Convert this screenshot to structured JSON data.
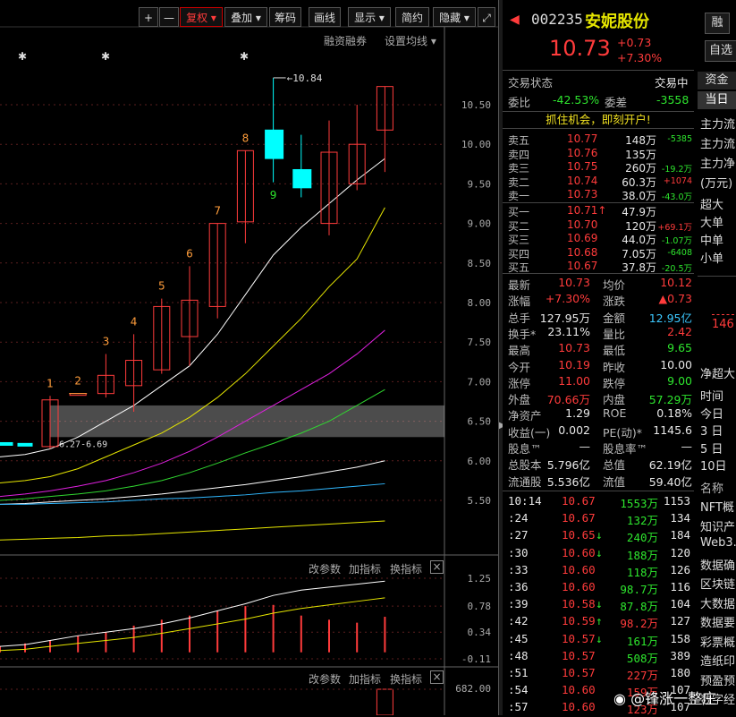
{
  "toolbar": {
    "plus": "+",
    "minus": "—",
    "fuquan": "复权",
    "diejia": "叠加",
    "chouma": "筹码",
    "huaxian": "画线",
    "xianshi": "显示",
    "jianyue": "简约",
    "yincang": "隐藏"
  },
  "chart_bar": {
    "rongzi": "融资融券",
    "shezhi": "设置均线"
  },
  "chart_data": {
    "type": "candlestick",
    "price_ticks": [
      "10.50",
      "10.00",
      "9.50",
      "9.00",
      "8.50",
      "8.00",
      "7.50",
      "7.00",
      "6.50",
      "6.00",
      "5.50"
    ],
    "candles": [
      {
        "open": 6.23,
        "close": 6.23,
        "high": 6.23,
        "low": 6.23,
        "color": "cyan"
      },
      {
        "open": 6.22,
        "close": 6.22,
        "high": 6.22,
        "low": 6.22,
        "color": "cyan"
      },
      {
        "open": 6.18,
        "close": 6.77,
        "high": 6.82,
        "low": 6.15,
        "color": "red"
      },
      {
        "open": 6.85,
        "close": 6.85,
        "high": 6.85,
        "low": 6.85,
        "color": "red"
      },
      {
        "open": 6.85,
        "close": 7.08,
        "high": 7.35,
        "low": 6.8,
        "color": "red"
      },
      {
        "open": 6.95,
        "close": 7.27,
        "high": 7.6,
        "low": 6.62,
        "color": "red"
      },
      {
        "open": 7.15,
        "close": 7.95,
        "high": 8.05,
        "low": 7.1,
        "color": "red"
      },
      {
        "open": 7.57,
        "close": 8.03,
        "high": 8.46,
        "low": 7.2,
        "color": "red"
      },
      {
        "open": 7.95,
        "close": 9.0,
        "high": 9.0,
        "low": 7.8,
        "color": "red"
      },
      {
        "open": 9.02,
        "close": 9.92,
        "high": 9.92,
        "low": 8.75,
        "color": "red"
      },
      {
        "open": 10.18,
        "close": 9.82,
        "high": 10.84,
        "low": 9.52,
        "color": "cyan"
      },
      {
        "open": 9.68,
        "close": 9.45,
        "high": 10.12,
        "low": 9.33,
        "color": "cyan"
      },
      {
        "open": 9.0,
        "close": 9.9,
        "high": 10.3,
        "low": 8.85,
        "color": "red"
      },
      {
        "open": 9.5,
        "close": 10.0,
        "high": 10.5,
        "low": 9.42,
        "color": "red"
      },
      {
        "open": 10.18,
        "close": 10.73,
        "high": 10.73,
        "low": 9.65,
        "color": "red"
      }
    ],
    "candle_labels": [
      "",
      "",
      "1",
      "2",
      "3",
      "4",
      "5",
      "6",
      "7",
      "8",
      "9",
      "",
      "",
      "",
      ""
    ],
    "max_label": "10.84",
    "range_label": "6.27-6.69",
    "band": [
      6.3,
      6.7
    ],
    "ma_lines": [
      {
        "color": "#ffffff",
        "values": [
          6.05,
          6.08,
          6.15,
          6.3,
          6.5,
          6.7,
          6.95,
          7.2,
          7.6,
          8.1,
          8.6,
          8.95,
          9.25,
          9.55,
          9.82
        ]
      },
      {
        "color": "#e6e600",
        "values": [
          5.72,
          5.75,
          5.8,
          5.9,
          6.05,
          6.2,
          6.35,
          6.55,
          6.8,
          7.1,
          7.45,
          7.8,
          8.2,
          8.55,
          9.2
        ]
      },
      {
        "color": "#e020e0",
        "values": [
          5.55,
          5.58,
          5.62,
          5.68,
          5.75,
          5.85,
          5.97,
          6.12,
          6.3,
          6.5,
          6.7,
          6.9,
          7.1,
          7.35,
          7.65
        ]
      },
      {
        "color": "#30d830",
        "values": [
          5.5,
          5.52,
          5.55,
          5.58,
          5.62,
          5.68,
          5.75,
          5.85,
          5.97,
          6.1,
          6.22,
          6.35,
          6.5,
          6.7,
          6.9
        ]
      },
      {
        "color": "#ffffff",
        "values": [
          5.45,
          5.46,
          5.48,
          5.5,
          5.52,
          5.55,
          5.58,
          5.62,
          5.66,
          5.7,
          5.75,
          5.8,
          5.86,
          5.92,
          6.0
        ]
      },
      {
        "color": "#30b8ff",
        "values": [
          5.45,
          5.45,
          5.46,
          5.47,
          5.48,
          5.5,
          5.52,
          5.53,
          5.55,
          5.57,
          5.6,
          5.62,
          5.65,
          5.68,
          5.71
        ]
      },
      {
        "color": "#e6e600",
        "values": [
          5.0,
          5.01,
          5.02,
          5.03,
          5.05,
          5.06,
          5.08,
          5.1,
          5.12,
          5.14,
          5.16,
          5.18,
          5.2,
          5.22,
          5.24
        ]
      }
    ],
    "indicator_ticks": [
      "1.25",
      "0.78",
      "0.34",
      "-0.11"
    ],
    "indicator_bars": [
      0.1,
      0.15,
      0.2,
      0.28,
      0.34,
      0.45,
      0.55,
      0.62,
      0.7,
      0.78,
      0.8,
      0.62,
      0.55,
      0.5,
      0.6
    ],
    "indicator_line1": [
      0.1,
      0.13,
      0.2,
      0.28,
      0.34,
      0.4,
      0.48,
      0.58,
      0.7,
      0.82,
      0.96,
      1.05,
      1.1,
      1.15,
      1.2
    ],
    "indicator_line2": [
      0.03,
      0.05,
      0.1,
      0.15,
      0.2,
      0.25,
      0.32,
      0.4,
      0.48,
      0.56,
      0.66,
      0.74,
      0.8,
      0.86,
      0.92
    ],
    "volume_tick": "682.00"
  },
  "indicator_bar": {
    "gai": "改参数",
    "jia": "加指标",
    "huan": "换指标",
    "close": "×"
  },
  "stock": {
    "code": "002235",
    "name": "安妮股份",
    "price": "10.73",
    "change": "+0.73",
    "change_pct": "+7.30%"
  },
  "status": {
    "label": "交易状态",
    "value": "交易中"
  },
  "weibi": {
    "label": "委比",
    "value": "-42.53%",
    "label2": "委差",
    "value2": "-3558"
  },
  "promo": "抓住机会，即刻开户!",
  "sells": [
    {
      "label": "卖五",
      "price": "10.77",
      "vol": "148万",
      "chg": "-5385",
      "chgcolor": "green"
    },
    {
      "label": "卖四",
      "price": "10.76",
      "vol": "135万",
      "chg": "",
      "chgcolor": "green"
    },
    {
      "label": "卖三",
      "price": "10.75",
      "vol": "260万",
      "chg": "-19.2万",
      "chgcolor": "green"
    },
    {
      "label": "卖二",
      "price": "10.74",
      "vol": "60.3万",
      "chg": "+1074",
      "chgcolor": "red"
    },
    {
      "label": "卖一",
      "price": "10.73",
      "vol": "38.0万",
      "chg": "-43.0万",
      "chgcolor": "green"
    }
  ],
  "buys": [
    {
      "label": "买一",
      "price": "10.71↑",
      "vol": "47.9万",
      "chg": "",
      "chgcolor": "green"
    },
    {
      "label": "买二",
      "price": "10.70",
      "vol": "120万",
      "chg": "+69.1万",
      "chgcolor": "red"
    },
    {
      "label": "买三",
      "price": "10.69",
      "vol": "44.0万",
      "chg": "-1.07万",
      "chgcolor": "green"
    },
    {
      "label": "买四",
      "price": "10.68",
      "vol": "7.05万",
      "chg": "-6408",
      "chgcolor": "green"
    },
    {
      "label": "买五",
      "price": "10.67",
      "vol": "37.8万",
      "chg": "-20.5万",
      "chgcolor": "green"
    }
  ],
  "stats": [
    {
      "l1": "最新",
      "v1": "10.73",
      "c1": "red",
      "l2": "均价",
      "v2": "10.12",
      "c2": "red"
    },
    {
      "l1": "涨幅",
      "v1": "+7.30%",
      "c1": "red",
      "l2": "涨跌",
      "v2": "▲0.73",
      "c2": "red"
    },
    {
      "l1": "总手",
      "v1": "127.95万",
      "c1": "white",
      "l2": "金额",
      "v2": "12.95亿",
      "c2": "cyan"
    },
    {
      "l1": "换手*",
      "v1": "23.11%",
      "c1": "white",
      "l2": "量比",
      "v2": "2.42",
      "c2": "red"
    },
    {
      "l1": "最高",
      "v1": "10.73",
      "c1": "red",
      "l2": "最低",
      "v2": "9.65",
      "c2": "green"
    },
    {
      "l1": "今开",
      "v1": "10.19",
      "c1": "red",
      "l2": "昨收",
      "v2": "10.00",
      "c2": "white"
    },
    {
      "l1": "涨停",
      "v1": "11.00",
      "c1": "red",
      "l2": "跌停",
      "v2": "9.00",
      "c2": "green"
    },
    {
      "l1": "外盘",
      "v1": "70.66万",
      "c1": "red",
      "l2": "内盘",
      "v2": "57.29万",
      "c2": "green"
    },
    {
      "l1": "净资产",
      "v1": "1.29",
      "c1": "white",
      "l2": "ROE",
      "v2": "0.18%",
      "c2": "white"
    },
    {
      "l1": "收益(一)",
      "v1": "0.002",
      "c1": "white",
      "l2": "PE(动)*",
      "v2": "1145.6",
      "c2": "white"
    },
    {
      "l1": "股息™",
      "v1": "—",
      "c1": "white",
      "l2": "股息率™",
      "v2": "—",
      "c2": "white"
    },
    {
      "l1": "总股本",
      "v1": "5.796亿",
      "c1": "white",
      "l2": "总值",
      "v2": "62.19亿",
      "c2": "white"
    },
    {
      "l1": "流通股",
      "v1": "5.536亿",
      "c1": "white",
      "l2": "流值",
      "v2": "59.40亿",
      "c2": "white"
    }
  ],
  "ticks": [
    {
      "time": "10:14",
      "price": "10.67",
      "arrow": "",
      "vol": "1553万",
      "n": "1153",
      "pc": "red",
      "vc": "green"
    },
    {
      "time": ":24",
      "price": "10.67",
      "arrow": "",
      "vol": "132万",
      "n": "134",
      "pc": "red",
      "vc": "green"
    },
    {
      "time": ":27",
      "price": "10.65",
      "arrow": "↓",
      "vol": "240万",
      "n": "184",
      "pc": "red",
      "vc": "green"
    },
    {
      "time": ":30",
      "price": "10.60",
      "arrow": "↓",
      "vol": "188万",
      "n": "120",
      "pc": "red",
      "vc": "green"
    },
    {
      "time": ":33",
      "price": "10.60",
      "arrow": "",
      "vol": "118万",
      "n": "126",
      "pc": "red",
      "vc": "green"
    },
    {
      "time": ":36",
      "price": "10.60",
      "arrow": "",
      "vol": "98.7万",
      "n": "116",
      "pc": "red",
      "vc": "green"
    },
    {
      "time": ":39",
      "price": "10.58",
      "arrow": "↓",
      "vol": "87.8万",
      "n": "104",
      "pc": "red",
      "vc": "green"
    },
    {
      "time": ":42",
      "price": "10.59",
      "arrow": "↑",
      "vol": "98.2万",
      "n": "127",
      "pc": "red",
      "vc": "red"
    },
    {
      "time": ":45",
      "price": "10.57",
      "arrow": "↓",
      "vol": "161万",
      "n": "158",
      "pc": "red",
      "vc": "green"
    },
    {
      "time": ":48",
      "price": "10.57",
      "arrow": "",
      "vol": "508万",
      "n": "389",
      "pc": "red",
      "vc": "green"
    },
    {
      "time": ":51",
      "price": "10.57",
      "arrow": "",
      "vol": "227万",
      "n": "180",
      "pc": "red",
      "vc": "red"
    },
    {
      "time": ":54",
      "price": "10.60",
      "arrow": "",
      "vol": "159万",
      "n": "107",
      "pc": "red",
      "vc": "red"
    },
    {
      "time": ":57",
      "price": "10.60",
      "arrow": "",
      "vol": "123万",
      "n": "107",
      "pc": "red",
      "vc": "red"
    }
  ],
  "far": {
    "btn1": "融",
    "btn2": "自选",
    "tab": "资金",
    "tab2": "当日",
    "labels": [
      "主力流",
      "主力流",
      "主力净",
      "(万元)",
      "超大",
      "大单",
      "中单",
      "小单"
    ],
    "value": "146",
    "jing": "净超大",
    "times": [
      "时间",
      "今日",
      "3 日",
      "5 日",
      "10日"
    ],
    "mingcheng": "名称",
    "concepts": [
      "NFT概",
      "知识产",
      "Web3.",
      "数据确",
      "区块链",
      "大数据",
      "数据要",
      "彩票概",
      "造纸印",
      "预盈预",
      "数字经"
    ]
  },
  "watermark": "@锋涨一整庄"
}
